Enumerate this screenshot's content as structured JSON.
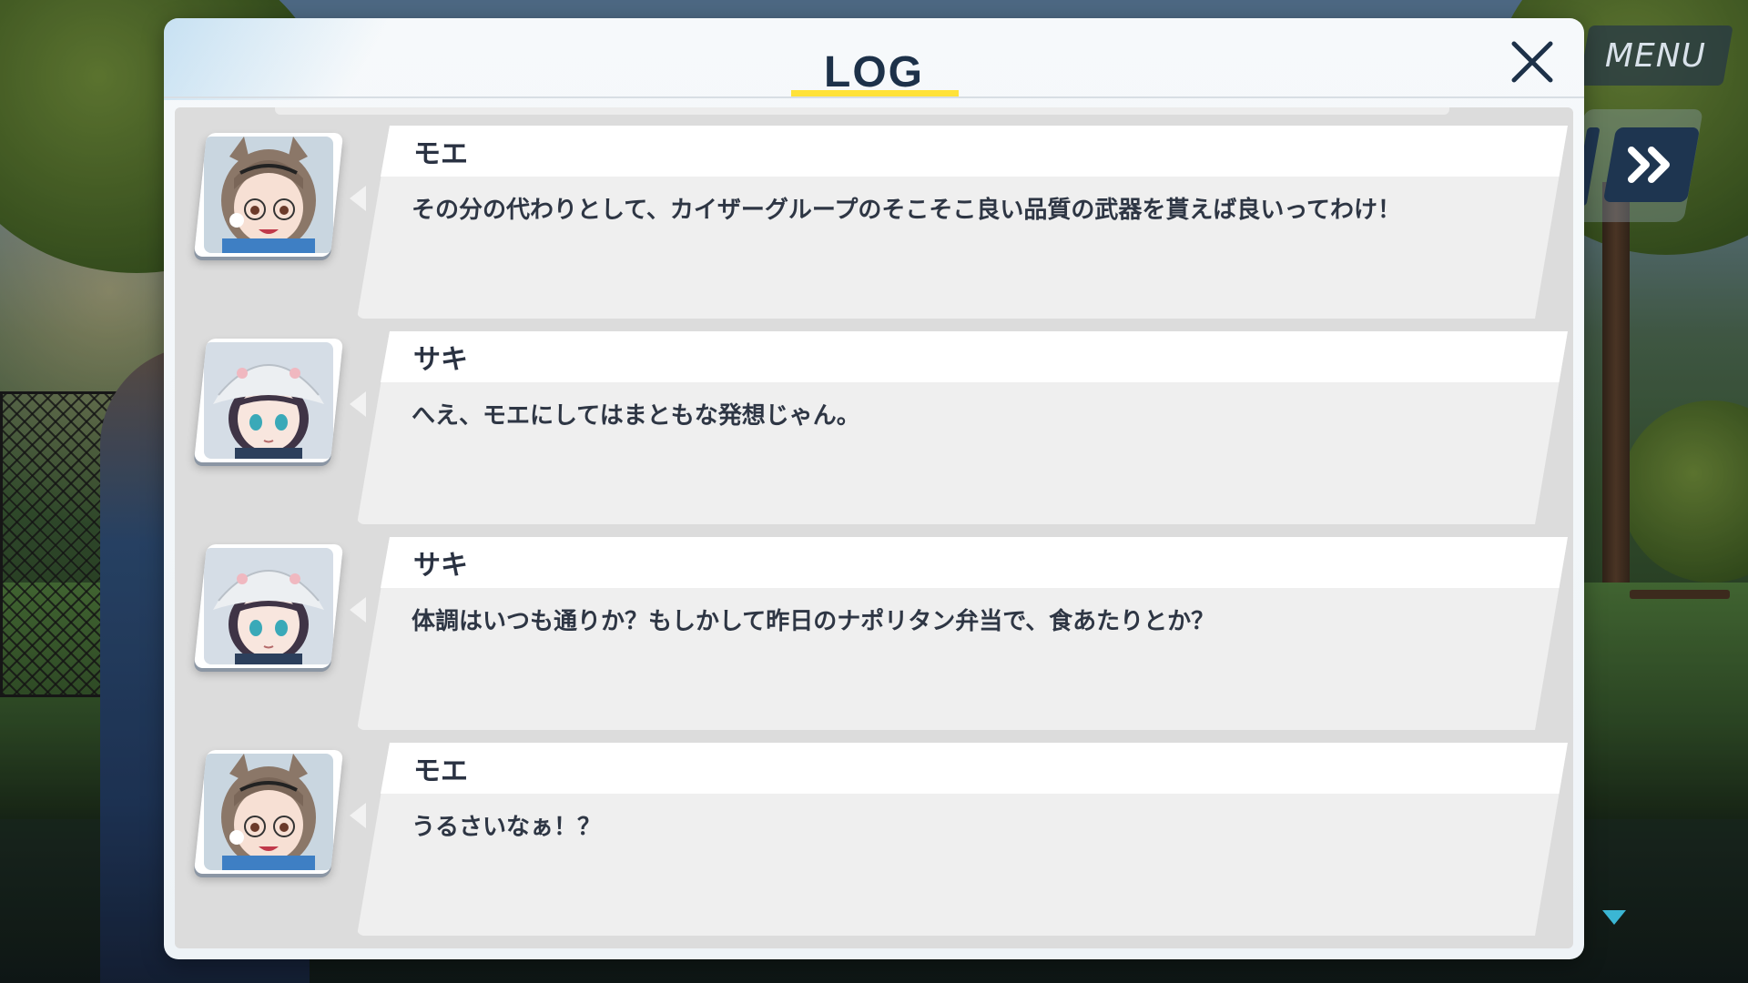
{
  "hud": {
    "menu_label": "MENU",
    "skip_icon": "double-chevron-right-icon",
    "next_icon": "triangle-down-icon"
  },
  "log": {
    "title": "LOG",
    "close_icon": "close-icon",
    "accent_color": "#ffe23a",
    "title_color": "#1d3149",
    "entries": [
      {
        "speaker": "モエ",
        "portrait": "moe-portrait",
        "text": "その分の代わりとして、カイザーグループのそこそこ良い品質の武器を貰えば良いってわけ！"
      },
      {
        "speaker": "サキ",
        "portrait": "saki-portrait",
        "text": "へえ、モエにしてはまともな発想じゃん。"
      },
      {
        "speaker": "サキ",
        "portrait": "saki-portrait",
        "text": "体調はいつも通りか？もしかして昨日のナポリタン弁当で、食あたりとか？"
      },
      {
        "speaker": "モエ",
        "portrait": "moe-portrait",
        "text": "うるさいなぁ！？"
      }
    ]
  }
}
